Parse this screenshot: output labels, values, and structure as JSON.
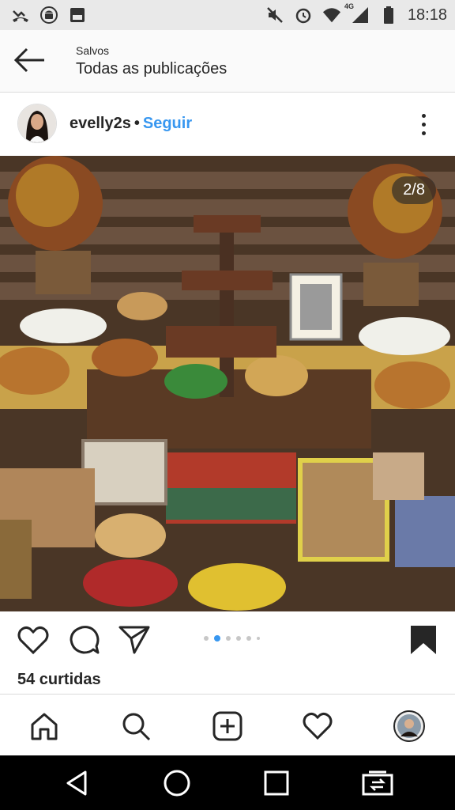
{
  "status_bar": {
    "time": "18:18",
    "network": "4G",
    "icons_left": [
      "missed-call-icon",
      "android-icon",
      "sim-icon"
    ],
    "icons_right": [
      "mute-icon",
      "alarm-icon",
      "wifi-icon",
      "signal-icon",
      "battery-icon"
    ]
  },
  "header": {
    "subtitle": "Salvos",
    "title": "Todas as publicações",
    "back_icon": "arrow-left-icon"
  },
  "post": {
    "username": "evelly2s",
    "separator": "•",
    "follow_label": "Seguir",
    "image_counter": "2/8",
    "likes": "54 curtidas",
    "carousel_current": 2,
    "carousel_total": 8
  },
  "tabs": [
    "home-icon",
    "search-icon",
    "add-post-icon",
    "heart-icon",
    "profile-avatar"
  ],
  "colors": {
    "accent": "#3897f0",
    "text": "#262626",
    "divider": "#dbdbdb"
  }
}
